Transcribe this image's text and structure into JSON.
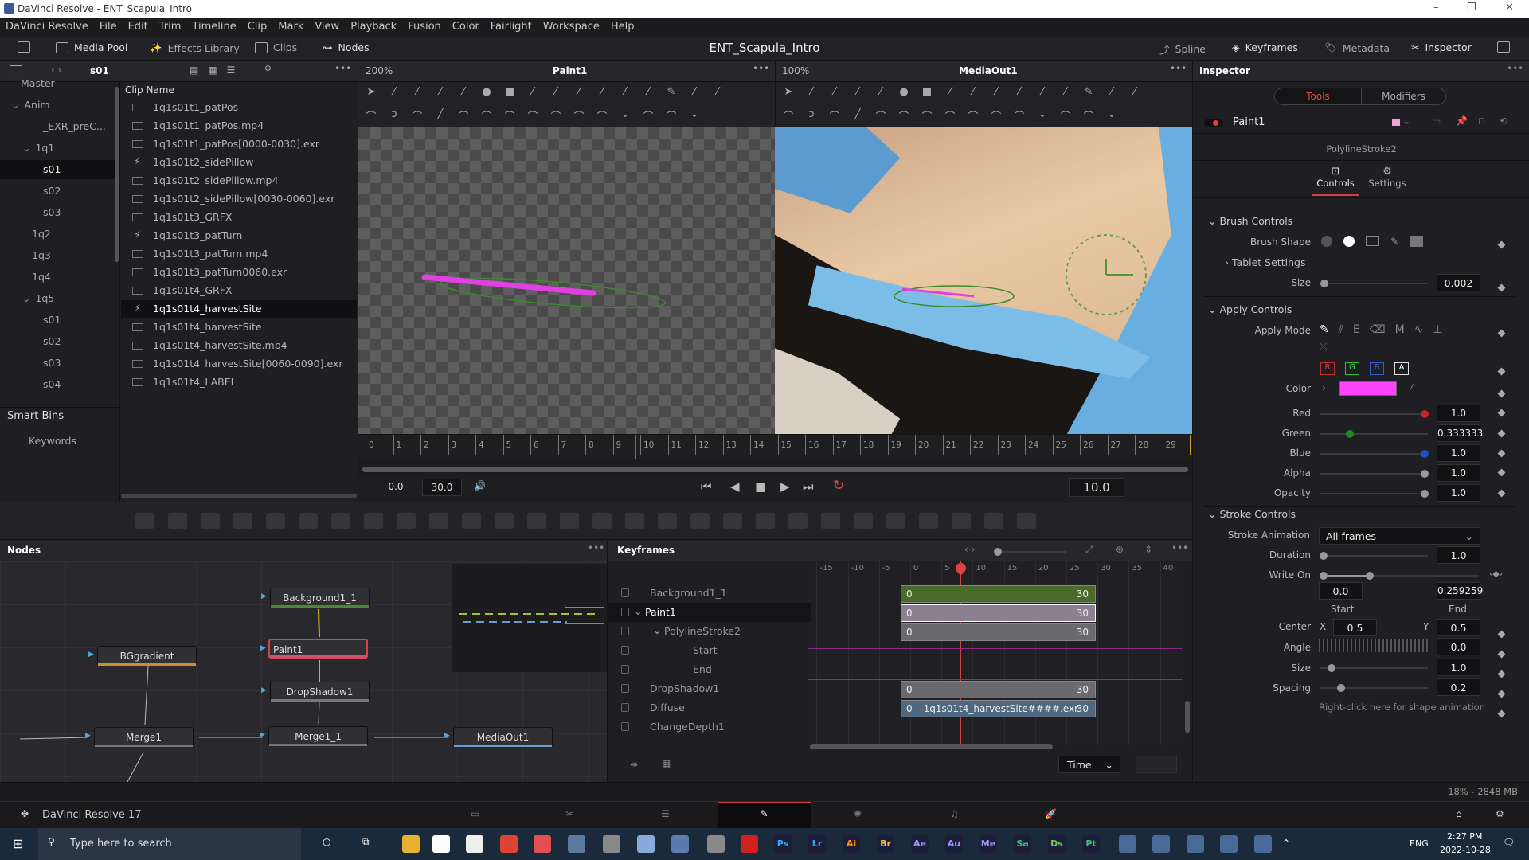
{
  "window": {
    "title": "DaVinci Resolve - ENT_Scapula_Intro",
    "controls": [
      "–",
      "❐",
      "✕"
    ]
  },
  "menu": [
    "DaVinci Resolve",
    "File",
    "Edit",
    "Trim",
    "Timeline",
    "Clip",
    "Mark",
    "View",
    "Playback",
    "Fusion",
    "Color",
    "Fairlight",
    "Workspace",
    "Help"
  ],
  "toolbar": {
    "media_pool": "Media Pool",
    "effects_library": "Effects Library",
    "clips": "Clips",
    "nodes": "Nodes",
    "project_title": "ENT_Scapula_Intro",
    "spline": "Spline",
    "keyframes": "Keyframes",
    "metadata": "Metadata",
    "inspector": "Inspector"
  },
  "media_pool": {
    "bin": "s01",
    "column_header": "Clip Name",
    "tree": [
      {
        "label": "Master",
        "indent": 1
      },
      {
        "label": "Anim",
        "indent": 1,
        "open": true
      },
      {
        "label": "_EXR_preC...",
        "indent": 3
      },
      {
        "label": "1q1",
        "indent": 2,
        "open": true
      },
      {
        "label": "s01",
        "indent": 3,
        "selected": true
      },
      {
        "label": "s02",
        "indent": 3
      },
      {
        "label": "s03",
        "indent": 3
      },
      {
        "label": "1q2",
        "indent": 2
      },
      {
        "label": "1q3",
        "indent": 2
      },
      {
        "label": "1q4",
        "indent": 2
      },
      {
        "label": "1q5",
        "indent": 2,
        "open": true
      },
      {
        "label": "s01",
        "indent": 3
      },
      {
        "label": "s02",
        "indent": 3
      },
      {
        "label": "s03",
        "indent": 3
      },
      {
        "label": "s04",
        "indent": 3
      }
    ],
    "smart_bins": "Smart Bins",
    "keywords": "Keywords",
    "clips": [
      "1q1s01t1_patPos",
      "1q1s01t1_patPos.mp4",
      "1q1s01t1_patPos[0000-0030].exr",
      "1q1s01t2_sidePillow",
      "1q1s01t2_sidePillow.mp4",
      "1q1s01t2_sidePillow[0030-0060].exr",
      "1q1s01t3_GRFX",
      "1q1s01t3_patTurn",
      "1q1s01t3_patTurn.mp4",
      "1q1s01t3_patTurn0060.exr",
      "1q1s01t4_GRFX",
      "1q1s01t4_harvestSite",
      "1q1s01t4_harvestSite",
      "1q1s01t4_harvestSite.mp4",
      "1q1s01t4_harvestSite[0060-0090].exr",
      "1q1s01t4_LABEL"
    ],
    "selected_clip": 11
  },
  "viewer1": {
    "zoom": "200%",
    "name": "Paint1"
  },
  "viewer2": {
    "zoom": "100%",
    "name": "MediaOut1"
  },
  "viewer_tools_row1": [
    "select-arrow-icon",
    "multistroke-icon",
    "clone-multistroke-icon",
    "stroke-icon",
    "polyline-stroke-icon",
    "circle-icon",
    "rectangle-icon",
    "paint-group-icon",
    "fill-icon",
    "wipe-icon",
    "eraser-icon",
    "transform-icon",
    "pen-add-icon",
    "pencil-icon",
    "pointer-plus-icon",
    "select-point-icon"
  ],
  "viewer_tools_row2": [
    "polygon-icon",
    "lasso-icon",
    "bspline-icon",
    "line-icon",
    "box-select-icon",
    "rotate-icon",
    "smooth-icon",
    "stretch-icon",
    "delete-icon",
    "reduce-icon",
    "insert-point-icon",
    "chevron-down-icon",
    "publish-icon",
    "magic-wand-icon",
    "chevron-down-icon"
  ],
  "ruler": {
    "ticks": [
      0,
      1,
      2,
      3,
      4,
      5,
      6,
      7,
      8,
      9,
      10,
      11,
      12,
      13,
      14,
      15,
      16,
      17,
      18,
      19,
      20,
      21,
      22,
      23,
      24,
      25,
      26,
      27,
      28,
      29,
      30
    ],
    "current": 10
  },
  "transport": {
    "start": "0.0",
    "end": "30.0",
    "current": "10.0"
  },
  "tools_bar": [
    "background-icon",
    "image-plane-icon",
    "text-icon",
    "paint-icon",
    "particles-icon",
    "color-corrector-icon",
    "curves-icon",
    "brightness-icon",
    "blur-icon",
    "merge-icon",
    "dissolve-icon",
    "matte-control-icon",
    "resize-icon",
    "transform-icon",
    "rectangle-mask-icon",
    "ellipse-mask-icon",
    "polygon-mask-icon",
    "bspline-mask-icon",
    "p-emitter-icon",
    "p-render-icon",
    "p-merge-icon",
    "shape3d-icon",
    "merge3d-icon",
    "text3d-icon",
    "renderer3d-icon",
    "camera3d-icon",
    "spotlight-icon",
    "image-plane3d-icon"
  ],
  "nodes_panel": {
    "title": "Nodes",
    "nodes": [
      "Background1_1",
      "Paint1",
      "BGgradient",
      "DropShadow1",
      "Merge1",
      "Merge1_1",
      "MediaOut1"
    ]
  },
  "keyframes_panel": {
    "title": "Keyframes",
    "axis": [
      -15,
      -10,
      -5,
      0,
      5,
      10,
      15,
      20,
      25,
      30,
      35,
      40
    ],
    "playhead": 8,
    "rows": [
      {
        "label": "Background1_1",
        "start": "0",
        "end": "30",
        "color": "#4a6a2a"
      },
      {
        "label": "Paint1",
        "start": "0",
        "end": "30",
        "color": "#8a8090"
      },
      {
        "label": "PolylineStroke2",
        "start": "0",
        "end": "30",
        "color": "#6a6a6e"
      },
      {
        "label": "Start"
      },
      {
        "label": "End"
      },
      {
        "label": "DropShadow1",
        "start": "0",
        "end": "30",
        "color": "#6a6a6e"
      },
      {
        "label": "Diffuse",
        "start": "0",
        "end": "30",
        "clip": "1q1s01t4_harvestSite####.exr",
        "color": "#4f6880"
      },
      {
        "label": "ChangeDepth1"
      }
    ],
    "time_mode": "Time"
  },
  "inspector": {
    "title": "Inspector",
    "tabs": [
      "Tools",
      "Modifiers"
    ],
    "tool": "Paint1",
    "stroke": "PolylineStroke2",
    "subtabs": [
      "Controls",
      "Settings"
    ],
    "brush_controls": "Brush Controls",
    "brush_shape": "Brush Shape",
    "tablet_settings": "Tablet Settings",
    "size_label": "Size",
    "size": "0.002",
    "apply_controls": "Apply Controls",
    "apply_mode": "Apply Mode",
    "channels": [
      "R",
      "G",
      "B",
      "A"
    ],
    "color_label": "Color",
    "color": "#ff44ff",
    "red_label": "Red",
    "red": "1.0",
    "green_label": "Green",
    "green": "0.333333",
    "blue_label": "Blue",
    "blue": "1.0",
    "alpha_label": "Alpha",
    "alpha": "1.0",
    "opacity_label": "Opacity",
    "opacity": "1.0",
    "stroke_controls": "Stroke Controls",
    "stroke_animation_label": "Stroke Animation",
    "stroke_animation": "All frames",
    "duration_label": "Duration",
    "duration": "1.0",
    "write_on_label": "Write On",
    "write_on_start": "0.0",
    "write_on_end": "0.259259",
    "start_label": "Start",
    "end_label": "End",
    "center_label": "Center",
    "x_label": "X",
    "center_x": "0.5",
    "y_label": "Y",
    "center_y": "0.5",
    "angle_label": "Angle",
    "angle": "0.0",
    "size2_label": "Size",
    "size2": "1.0",
    "spacing_label": "Spacing",
    "spacing": "0.2",
    "hint": "Right-click here for shape animation"
  },
  "status": {
    "memory": "18% - 2848 MB",
    "app": "DaVinci Resolve 17"
  },
  "taskbar": {
    "search_placeholder": "Type here to search",
    "apps": [
      "Ps",
      "Lr",
      "Ai",
      "Br",
      "Ae",
      "Au",
      "Me",
      "Sa",
      "Ds",
      "Pt"
    ],
    "lang": "ENG",
    "time": "2:27 PM",
    "date": "2022-10-28",
    "notifications": "2"
  }
}
